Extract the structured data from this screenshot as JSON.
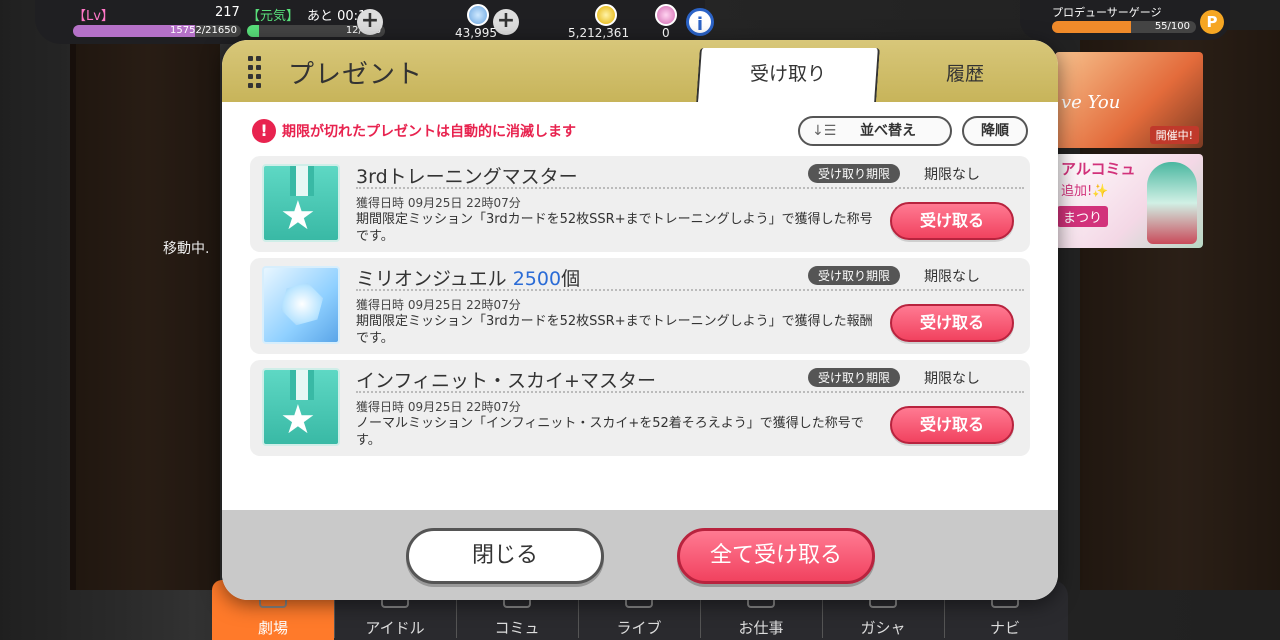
{
  "hud": {
    "lv_label": "【Lv】",
    "lv_value": "217",
    "genki_label": "【元気】",
    "timer": "あと 00:13",
    "exp": "15752/21650",
    "exp_ratio": 0.7276,
    "stamina": "12/136",
    "stamina_ratio": 0.088,
    "jewels": "43,995",
    "coins": "5,212,361",
    "tickets": "0",
    "info_label": "i"
  },
  "gauge": {
    "label": "プロデューサーゲージ",
    "value": "55/100",
    "ratio": 0.55,
    "icon": "P"
  },
  "background": {
    "moving_text": "移動中."
  },
  "banners": {
    "event_title": "ve You",
    "event_badge": "開催中!",
    "commu_line1": "アルコミュ",
    "commu_line2": "追加!✨",
    "commu_line3": "まつり"
  },
  "modal": {
    "title": "プレゼント",
    "tabs": [
      {
        "label": "受け取り",
        "active": true
      },
      {
        "label": "履歴",
        "active": false
      }
    ],
    "notice": "期限が切れたプレゼントは自動的に消滅します",
    "notice_icon": "!",
    "sort_label": "並べ替え",
    "sort_icon": "↓☰",
    "order_label": "降順",
    "limit_badge": "受け取り期限",
    "receive_label": "受け取る",
    "items": [
      {
        "icon": "medal-title-icon",
        "name": "3rdトレーニングマスター",
        "qty": "",
        "limit": "期限なし",
        "date": "獲得日時 09月25日 22時07分",
        "desc": "期間限定ミッション「3rdカードを52枚SSR+までトレーニングしよう」で獲得した称号です。"
      },
      {
        "icon": "million-jewel-icon",
        "name": "ミリオンジュエル ",
        "qty": "2500",
        "qty_unit": "個",
        "limit": "期限なし",
        "date": "獲得日時 09月25日 22時07分",
        "desc": "期間限定ミッション「3rdカードを52枚SSR+までトレーニングしよう」で獲得した報酬です。"
      },
      {
        "icon": "medal-title-icon",
        "name": "インフィニット・スカイ+マスター",
        "qty": "",
        "limit": "期限なし",
        "date": "獲得日時 09月25日 22時07分",
        "desc": "ノーマルミッション「インフィニット・スカイ+を52着そろえよう」で獲得した称号です。"
      }
    ],
    "close_label": "閉じる",
    "receive_all_label": "全て受け取る"
  },
  "nav": [
    {
      "label": "劇場",
      "active": true
    },
    {
      "label": "アイドル",
      "active": false
    },
    {
      "label": "コミュ",
      "active": false
    },
    {
      "label": "ライブ",
      "active": false
    },
    {
      "label": "お仕事",
      "active": false
    },
    {
      "label": "ガシャ",
      "active": false
    },
    {
      "label": "ナビ",
      "active": false
    }
  ],
  "colors": {
    "accent_pink": "#f1425f",
    "header_gold": "#c7b45a",
    "notice_red": "#e8234f",
    "qty_blue": "#2a6bd6",
    "nav_active": "#ff7a2a"
  }
}
